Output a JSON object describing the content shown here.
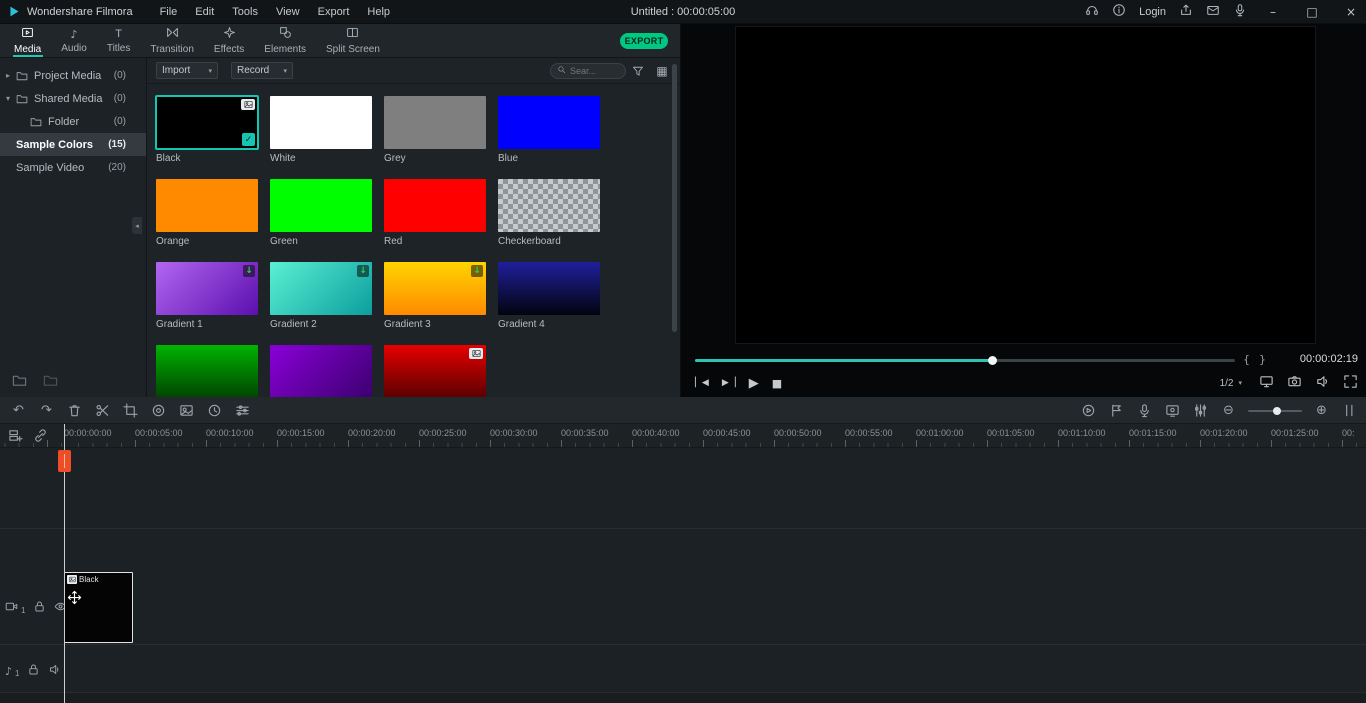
{
  "app": {
    "brand": "Wondershare Filmora",
    "menus": [
      "File",
      "Edit",
      "Tools",
      "View",
      "Export",
      "Help"
    ],
    "title": "Untitled : 00:00:05:00",
    "login_label": "Login",
    "topbar_icons": [
      "headset-icon",
      "info-icon",
      "publish-icon",
      "mail-icon",
      "mic-icon"
    ],
    "window_controls": [
      "minimize-button",
      "maximize-button",
      "close-button"
    ]
  },
  "glyphs": {
    "caret_down": "▾",
    "arrow_collapsed": "▸",
    "arrow_expanded": "▾",
    "note": "♪",
    "titles": "T",
    "undo": "↶",
    "redo": "↷",
    "zoom_out": "⊖",
    "zoom_in": "⊕",
    "grid": "▦",
    "play": "▶",
    "stop": "■",
    "prev": "◀",
    "next": "▶",
    "bar_left": "▏",
    "bar_right": "▕",
    "brace_open": "{",
    "brace_close": "}",
    "check": "✓",
    "download": "↓",
    "minimize": "–",
    "maximize": "□",
    "close": "×",
    "collapse": "◂"
  },
  "tabs": {
    "export_label": "EXPORT",
    "items": [
      {
        "label": "Media",
        "icon": "media-icon",
        "active": true
      },
      {
        "label": "Audio",
        "icon": "audio-icon",
        "active": false
      },
      {
        "label": "Titles",
        "icon": "titles-icon",
        "active": false
      },
      {
        "label": "Transition",
        "icon": "transition-icon",
        "active": false
      },
      {
        "label": "Effects",
        "icon": "effects-icon",
        "active": false
      },
      {
        "label": "Elements",
        "icon": "elements-icon",
        "active": false
      },
      {
        "label": "Split Screen",
        "icon": "split-screen-icon",
        "active": false
      }
    ]
  },
  "media_panel": {
    "import_label": "Import",
    "record_label": "Record",
    "search_placeholder": "Sear...",
    "toolbar_icons": [
      "search-icon",
      "filter-icon",
      "grid-view-icon"
    ],
    "sidebar": [
      {
        "label": "Project Media",
        "count": "(0)",
        "icon": "folder-icon",
        "arrow": "collapsed",
        "selected": false,
        "indent": false
      },
      {
        "label": "Shared Media",
        "count": "(0)",
        "icon": "folder-icon",
        "arrow": "expanded",
        "selected": false,
        "indent": false
      },
      {
        "label": "Folder",
        "count": "(0)",
        "icon": "folder-icon",
        "arrow": null,
        "selected": false,
        "indent": true
      },
      {
        "label": "Sample Colors",
        "count": "(15)",
        "icon": null,
        "arrow": null,
        "selected": true,
        "indent": false
      },
      {
        "label": "Sample Video",
        "count": "(20)",
        "icon": null,
        "arrow": null,
        "selected": false,
        "indent": false
      }
    ],
    "items": [
      {
        "label": "Black",
        "fill": "#000000",
        "selected": true,
        "badges": [
          "image",
          "check"
        ]
      },
      {
        "label": "White",
        "fill": "#ffffff",
        "selected": false,
        "badges": []
      },
      {
        "label": "Grey",
        "fill": "#7f7f7f",
        "selected": false,
        "badges": []
      },
      {
        "label": "Blue",
        "fill": "#0000fe",
        "selected": false,
        "badges": []
      },
      {
        "label": "Orange",
        "fill": "#ff8a00",
        "selected": false,
        "badges": []
      },
      {
        "label": "Green",
        "fill": "#00fe00",
        "selected": false,
        "badges": []
      },
      {
        "label": "Red",
        "fill": "#fe0000",
        "selected": false,
        "badges": []
      },
      {
        "label": "Checkerboard",
        "fill": "checker",
        "selected": false,
        "badges": []
      },
      {
        "label": "Gradient 1",
        "fill": "linear-gradient(135deg,#b266f0,#5b0fae)",
        "selected": false,
        "badges": [
          "download"
        ]
      },
      {
        "label": "Gradient 2",
        "fill": "linear-gradient(135deg,#59f0d2,#0b9e9e)",
        "selected": false,
        "badges": [
          "download"
        ]
      },
      {
        "label": "Gradient 3",
        "fill": "linear-gradient(180deg,#ffd400,#ff8a00)",
        "selected": false,
        "badges": [
          "download"
        ]
      },
      {
        "label": "Gradient 4",
        "fill": "linear-gradient(180deg,#1f1f9a,#03030f)",
        "selected": false,
        "badges": []
      },
      {
        "label": "",
        "fill": "linear-gradient(180deg,#00b400,#004400)",
        "selected": false,
        "badges": []
      },
      {
        "label": "",
        "fill": "linear-gradient(135deg,#8a00d8,#3c0070)",
        "selected": false,
        "badges": []
      },
      {
        "label": "",
        "fill": "linear-gradient(180deg,#e60000,#5a0000)",
        "selected": false,
        "badges": [
          "image"
        ]
      }
    ]
  },
  "preview": {
    "timecode": "00:00:02:19",
    "progress_pct": 55,
    "zoom_level": "1/2",
    "controls": [
      "prev-frame",
      "next-frame",
      "play",
      "stop"
    ],
    "right_icons": [
      "monitor-icon",
      "snapshot-icon",
      "volume-icon",
      "fullscreen-icon"
    ]
  },
  "timeline": {
    "toolbar_left_icons": [
      "undo-icon",
      "redo-icon",
      "delete-icon",
      "split-icon",
      "crop-icon",
      "color-icon",
      "green-screen-icon",
      "speed-icon",
      "adjust-icon"
    ],
    "toolbar_right_icons": [
      "render-preview-icon",
      "marker-icon",
      "voiceover-icon",
      "screen-record-icon",
      "audio-mixer-icon",
      "zoom-out-icon",
      "zoom-slider",
      "zoom-in-icon",
      "fit-timeline-icon"
    ],
    "zoom_slider_pct": 54,
    "ruler_labels": [
      "00:00:00:00",
      "00:00:05:00",
      "00:00:10:00",
      "00:00:15:00",
      "00:00:20:00",
      "00:00:25:00",
      "00:00:30:00",
      "00:00:35:00",
      "00:00:40:00",
      "00:00:45:00",
      "00:00:50:00",
      "00:00:55:00",
      "00:01:00:00",
      "00:01:05:00",
      "00:01:10:00",
      "00:01:15:00",
      "00:01:20:00",
      "00:01:25:00",
      "00:"
    ],
    "video_track_number": "1",
    "audio_track_number": "1",
    "clip": {
      "label": "Black"
    }
  },
  "colors": {
    "accent_teal": "#1ec8b6",
    "export_green": "#00c781",
    "playhead_red": "#ee4e26",
    "selection_teal": "#14c5b2",
    "clip_border": "#dfe3e5"
  }
}
